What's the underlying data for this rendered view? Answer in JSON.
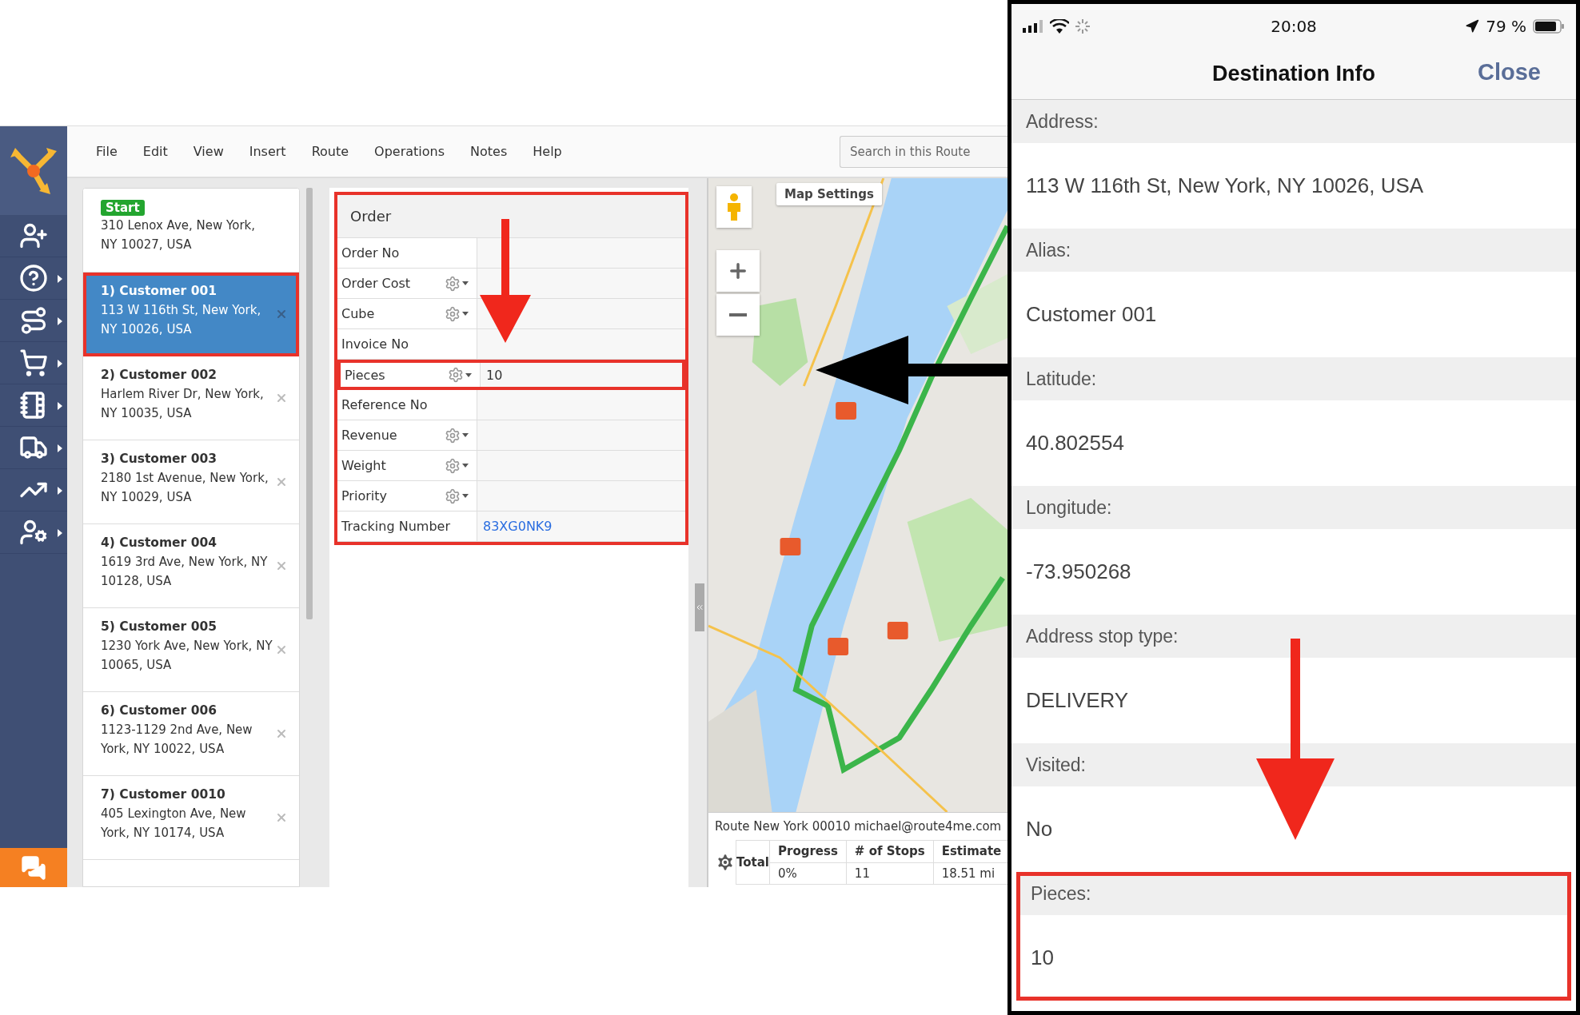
{
  "sidebar": {
    "items": [
      {
        "kind": "add-user",
        "submenu": false
      },
      {
        "kind": "help",
        "submenu": true
      },
      {
        "kind": "routes",
        "submenu": true
      },
      {
        "kind": "cart",
        "submenu": true
      },
      {
        "kind": "notebook",
        "submenu": true
      },
      {
        "kind": "team",
        "submenu": true
      },
      {
        "kind": "analytics",
        "submenu": true
      },
      {
        "kind": "user-settings",
        "submenu": true
      }
    ]
  },
  "menu": [
    "File",
    "Edit",
    "View",
    "Insert",
    "Route",
    "Operations",
    "Notes",
    "Help"
  ],
  "search": {
    "placeholder": "Search in this Route"
  },
  "stops": [
    {
      "kind": "start",
      "badge": "Start",
      "address": "310 Lenox Ave, New York, NY 10027, USA",
      "selected": false,
      "highlighted": false
    },
    {
      "kind": "stop",
      "title": "1) Customer 001",
      "address": "113 W 116th St, New York, NY 10026, USA",
      "selected": true,
      "highlighted": true
    },
    {
      "kind": "stop",
      "title": "2) Customer 002",
      "address": "Harlem River Dr, New York, NY 10035, USA",
      "selected": false,
      "highlighted": false
    },
    {
      "kind": "stop",
      "title": "3) Customer 003",
      "address": "2180 1st Avenue, New York, NY 10029, USA",
      "selected": false,
      "highlighted": false
    },
    {
      "kind": "stop",
      "title": "4) Customer 004",
      "address": "1619 3rd Ave, New York, NY 10128, USA",
      "selected": false,
      "highlighted": false
    },
    {
      "kind": "stop",
      "title": "5) Customer 005",
      "address": "1230 York Ave, New York, NY 10065, USA",
      "selected": false,
      "highlighted": false
    },
    {
      "kind": "stop",
      "title": "6) Customer 006",
      "address": "1123-1129 2nd Ave, New York, NY 10022, USA",
      "selected": false,
      "highlighted": false
    },
    {
      "kind": "stop",
      "title": "7) Customer 0010",
      "address": "405 Lexington Ave, New York, NY 10174, USA",
      "selected": false,
      "highlighted": false
    }
  ],
  "order": {
    "title": "Order",
    "highlighted": true,
    "fields": [
      {
        "label": "Order No",
        "gear": false,
        "highlighted": false
      },
      {
        "label": "Order Cost",
        "gear": true,
        "highlighted": false
      },
      {
        "label": "Cube",
        "gear": true,
        "highlighted": false
      },
      {
        "label": "Invoice No",
        "gear": false,
        "highlighted": false
      },
      {
        "label": "Pieces",
        "gear": true,
        "value": "10",
        "highlighted": true
      },
      {
        "label": "Reference No",
        "gear": false,
        "highlighted": false
      },
      {
        "label": "Revenue",
        "gear": true,
        "highlighted": false
      },
      {
        "label": "Weight",
        "gear": true,
        "highlighted": false
      },
      {
        "label": "Priority",
        "gear": true,
        "highlighted": false
      },
      {
        "label": "Tracking Number",
        "gear": false,
        "value": "83XG0NK9",
        "link": true,
        "highlighted": false
      }
    ]
  },
  "map": {
    "settings_button": "Map Settings"
  },
  "route_summary": {
    "title": "Route New York 00010 michael@route4me.com",
    "total_label": "Total",
    "columns": [
      {
        "header": "Progress",
        "value": "0%"
      },
      {
        "header": "# of Stops",
        "value": "11"
      },
      {
        "header": "Estimate",
        "value": "18.51 mi"
      }
    ]
  },
  "phone": {
    "status": {
      "time": "20:08",
      "battery": "79 %"
    },
    "title": "Destination Info",
    "close": "Close",
    "sections": [
      {
        "label": "Address:",
        "value": "113 W 116th St, New York, NY 10026, USA",
        "highlighted": false
      },
      {
        "label": "Alias:",
        "value": "Customer 001",
        "highlighted": false
      },
      {
        "label": "Latitude:",
        "value": "40.802554",
        "highlighted": false
      },
      {
        "label": "Longitude:",
        "value": "-73.950268",
        "highlighted": false
      },
      {
        "label": "Address stop type:",
        "value": "DELIVERY",
        "highlighted": false
      },
      {
        "label": "Visited:",
        "value": "No",
        "highlighted": false
      },
      {
        "label": "Pieces:",
        "value": "10",
        "highlighted": true
      }
    ]
  }
}
